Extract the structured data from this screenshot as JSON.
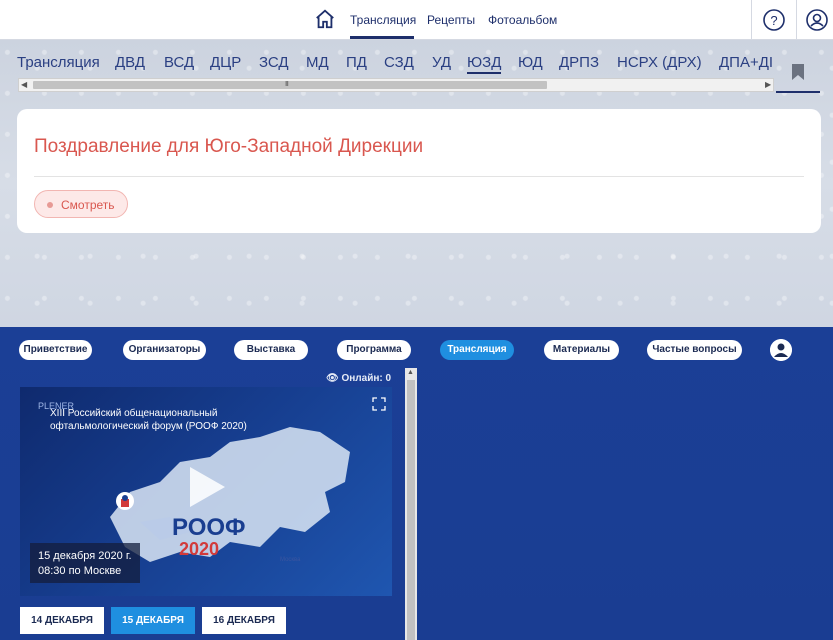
{
  "topnav": {
    "links": [
      "Трансляция",
      "Рецепты",
      "Фотоальбом"
    ],
    "icons": [
      "home-icon",
      "help-icon",
      "user-icon"
    ]
  },
  "tabs": [
    "Трансляция",
    "ДВД",
    "ВСД",
    "ДЦР",
    "ЗСД",
    "МД",
    "ПД",
    "СЗД",
    "УД",
    "ЮЗД",
    "ЮД",
    "ДРПЗ",
    "НСРХ (ДРХ)",
    "ДПА+ДІ"
  ],
  "active_tab": "ЮЗД",
  "scroll_grip": "III",
  "card": {
    "title": "Поздравление для Юго-Западной Дирекции",
    "button": "Смотреть"
  },
  "embed": {
    "menu": [
      "Приветствие",
      "Организаторы",
      "Выставка",
      "Программа",
      "Трансляция",
      "Материалы",
      "Частые вопросы"
    ],
    "active_menu": "Трансляция",
    "online_label": "Онлайн: 0",
    "video": {
      "brand": "PLENER",
      "forum": "XIII Российский общенациональный офтальмологический форум (РООФ 2020)",
      "roof": "РООФ",
      "year": "2020",
      "date_line1": "15 декабря 2020 г.",
      "date_line2": "08:30 по Москве",
      "city": "Москва"
    },
    "dates": [
      "14 ДЕКАБРЯ",
      "15 ДЕКАБРЯ",
      "16 ДЕКАБРЯ"
    ],
    "active_date": "15 ДЕКАБРЯ"
  },
  "colors": {
    "nav_text": "#1e2f6b",
    "card_title": "#d9574f",
    "embed_bg": "#1b3f96",
    "active_pill": "#1f8fe0"
  }
}
